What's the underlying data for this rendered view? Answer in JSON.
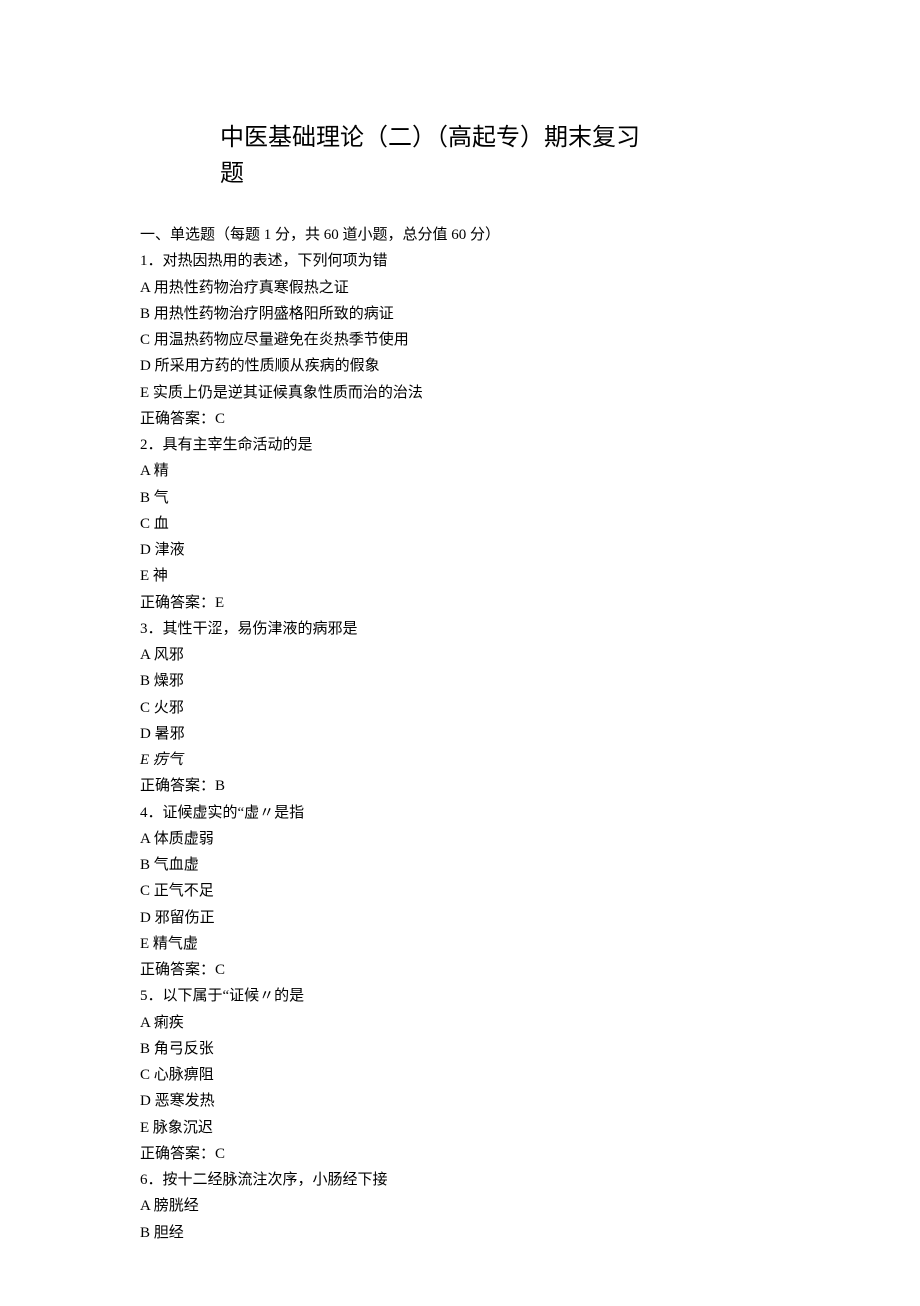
{
  "title": "中医基础理论（二）（高起专）期末复习题",
  "section_header": "一、单选题（每题 1 分，共 60 道小题，总分值 60 分）",
  "questions": [
    {
      "num": "1",
      "stem": "．对热因热用的表述，下列何项为错",
      "options": [
        {
          "k": "A",
          "t": " 用热性药物治疗真寒假热之证"
        },
        {
          "k": "B",
          "t": " 用热性药物治疗阴盛格阳所致的病证"
        },
        {
          "k": "C",
          "t": " 用温热药物应尽量避免在炎热季节使用"
        },
        {
          "k": "D",
          "t": " 所采用方药的性质顺从疾病的假象"
        },
        {
          "k": "E",
          "t": " 实质上仍是逆其证候真象性质而治的治法"
        }
      ],
      "answer_label": "正确答案：",
      "answer": "C"
    },
    {
      "num": "2",
      "stem": "．具有主宰生命活动的是",
      "options": [
        {
          "k": "A",
          "t": " 精"
        },
        {
          "k": "B",
          "t": " 气"
        },
        {
          "k": "C",
          "t": " 血"
        },
        {
          "k": "D",
          "t": " 津液"
        },
        {
          "k": "E",
          "t": " 神"
        }
      ],
      "answer_label": "正确答案：",
      "answer": "E"
    },
    {
      "num": "3",
      "stem": "．其性干涩，易伤津液的病邪是",
      "options": [
        {
          "k": "A",
          "t": " 风邪"
        },
        {
          "k": "B",
          "t": " 燥邪"
        },
        {
          "k": "C",
          "t": " 火邪"
        },
        {
          "k": "D",
          "t": " 暑邪"
        },
        {
          "k": "E",
          "t": " 疠气",
          "italic": true
        }
      ],
      "answer_label": "正确答案：",
      "answer": "B"
    },
    {
      "num": "4",
      "stem": "．证候虚实的“虚〃是指",
      "options": [
        {
          "k": "A",
          "t": " 体质虚弱"
        },
        {
          "k": "B",
          "t": " 气血虚"
        },
        {
          "k": "C",
          "t": " 正气不足"
        },
        {
          "k": "D",
          "t": " 邪留伤正"
        },
        {
          "k": "E",
          "t": " 精气虚"
        }
      ],
      "answer_label": "正确答案：",
      "answer": "C"
    },
    {
      "num": "5",
      "stem": "．以下属于“证候〃的是",
      "options": [
        {
          "k": "A",
          "t": " 痢疾"
        },
        {
          "k": "B",
          "t": " 角弓反张"
        },
        {
          "k": "C",
          "t": " 心脉痹阻"
        },
        {
          "k": "D",
          "t": " 恶寒发热"
        },
        {
          "k": "E",
          "t": " 脉象沉迟"
        }
      ],
      "answer_label": "正确答案：",
      "answer": "C"
    },
    {
      "num": "6",
      "stem": "．按十二经脉流注次序，小肠经下接",
      "options": [
        {
          "k": "A",
          "t": " 膀胱经"
        },
        {
          "k": "B",
          "t": " 胆经"
        }
      ]
    }
  ]
}
